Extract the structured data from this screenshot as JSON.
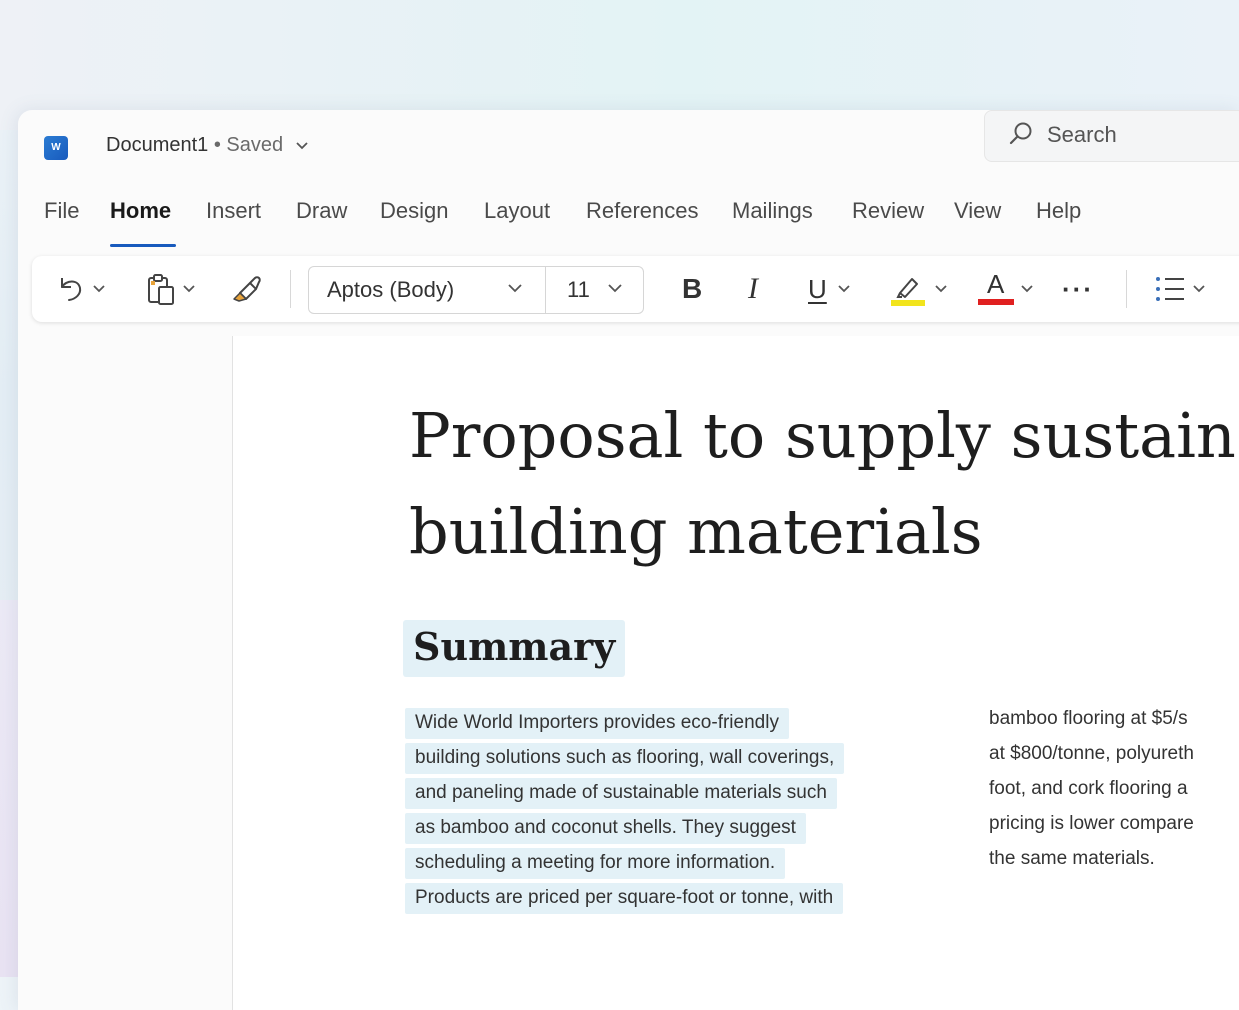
{
  "title_bar": {
    "doc_name": "Document1",
    "separator": "•",
    "save_status": "Saved",
    "search_placeholder": "Search"
  },
  "menu": {
    "items": [
      "File",
      "Home",
      "Insert",
      "Draw",
      "Design",
      "Layout",
      "References",
      "Mailings",
      "Review",
      "View",
      "Help"
    ],
    "active": "Home"
  },
  "toolbar": {
    "font_name": "Aptos (Body)",
    "font_size": "11",
    "bold_label": "B",
    "italic_label": "I",
    "underline_label": "U",
    "font_color_label": "A",
    "more_label": "···",
    "highlight_color": "#f2e41c",
    "font_color": "#e02020"
  },
  "document": {
    "title_line1": "Proposal to supply sustain",
    "title_line2": "building materials",
    "section_heading": "Summary",
    "column1": [
      "Wide World Importers provides eco-friendly",
      "building solutions such as flooring, wall coverings,",
      "and paneling made of sustainable materials such",
      "as bamboo and coconut shells. They suggest",
      "scheduling a meeting for more information.",
      "Products are priced per square-foot or tonne, with"
    ],
    "column2": [
      "bamboo flooring at $5/s",
      "at $800/tonne, polyureth",
      "foot, and cork flooring a",
      "pricing is lower compare",
      "the same materials."
    ]
  },
  "colors": {
    "accent": "#185abd",
    "selection_highlight": "#e3f1f7"
  }
}
